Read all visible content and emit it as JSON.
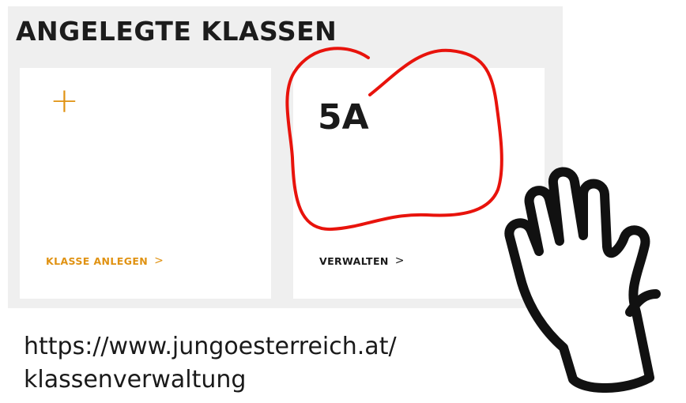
{
  "header": {
    "title": "ANGELEGTE KLASSEN"
  },
  "cards": {
    "add": {
      "icon": "+",
      "link_label": "KLASSE ANLEGEN",
      "chevron": ">"
    },
    "class": {
      "name": "5A",
      "link_label": "VERWALTEN",
      "chevron": ">"
    }
  },
  "caption": {
    "url_line1": "https://www.jungoesterreich.at/",
    "url_line2": "klassenverwaltung"
  },
  "annotations": {
    "circle_color": "#e8130c",
    "hand_icon": "raised-hand-icon",
    "accent": "#e09212"
  }
}
